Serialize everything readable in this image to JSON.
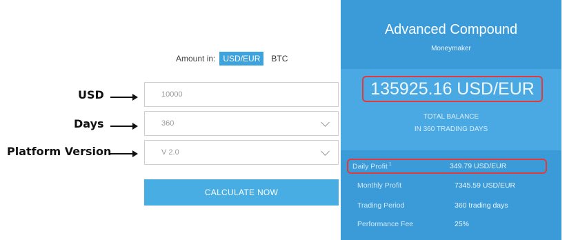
{
  "amount": {
    "label": "Amount in:",
    "options": [
      {
        "label": "USD/EUR",
        "active": true
      },
      {
        "label": "BTC",
        "active": false
      }
    ]
  },
  "annotations": {
    "usd": "USD",
    "days": "Days",
    "platform": "Platform Version"
  },
  "form": {
    "usd_value": "10000",
    "days_value": "360",
    "version_value": "V 2.0",
    "calculate_label": "CALCULATE NOW"
  },
  "panel": {
    "title": "Advanced Compound",
    "subtitle": "Moneymaker",
    "balance": "135925.16 USD/EUR",
    "balance_label_1": "TOTAL BALANCE",
    "balance_label_2": "IN 360 TRADING DAYS",
    "rows": [
      {
        "label": "Daily Profit",
        "sup": "1",
        "value": "349.79 USD/EUR"
      },
      {
        "label": "Monthly Profit",
        "value": "7345.59 USD/EUR"
      },
      {
        "label": "Trading Period",
        "value": "360 trading days"
      },
      {
        "label": "Performance Fee",
        "value": "25%"
      }
    ]
  },
  "colors": {
    "panel_bg": "#3b9bd8",
    "band_bg": "#4aa9e2",
    "button": "#47ade3",
    "highlight": "#e23a3a"
  }
}
